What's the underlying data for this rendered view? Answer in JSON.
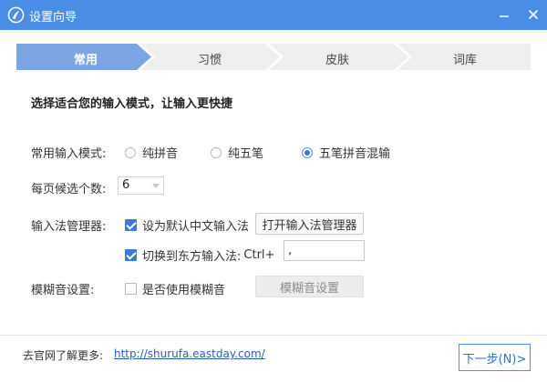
{
  "window": {
    "title": "设置向导",
    "minimize_symbol": "—",
    "close_symbol": "✕",
    "accent_color": "#4a8ee8"
  },
  "steps": [
    {
      "label": "常用",
      "active": true
    },
    {
      "label": "习惯",
      "active": false
    },
    {
      "label": "皮肤",
      "active": false
    },
    {
      "label": "词库",
      "active": false
    }
  ],
  "heading": "选择适合您的输入模式，让输入更快捷",
  "input_mode": {
    "label": "常用输入模式:",
    "options": [
      {
        "label": "纯拼音",
        "selected": false
      },
      {
        "label": "纯五笔",
        "selected": false
      },
      {
        "label": "五笔拼音混输",
        "selected": true
      }
    ]
  },
  "candidates": {
    "label": "每页候选个数:",
    "value": "6"
  },
  "ime_manager": {
    "label": "输入法管理器:",
    "default_checkbox": {
      "label": "设为默认中文输入法",
      "checked": true
    },
    "open_button": "打开输入法管理器",
    "switch_checkbox": {
      "label": "切换到东方输入法:",
      "checked": true
    },
    "hotkey_prefix": "Ctrl+",
    "hotkey_value": ","
  },
  "fuzzy": {
    "label": "模糊音设置:",
    "checkbox": {
      "label": "是否使用模糊音",
      "checked": false
    },
    "button": "模糊音设置"
  },
  "footer": {
    "text": "去官网了解更多:",
    "link": "http://shurufa.eastday.com/",
    "next_button": "下一步(N)>"
  }
}
